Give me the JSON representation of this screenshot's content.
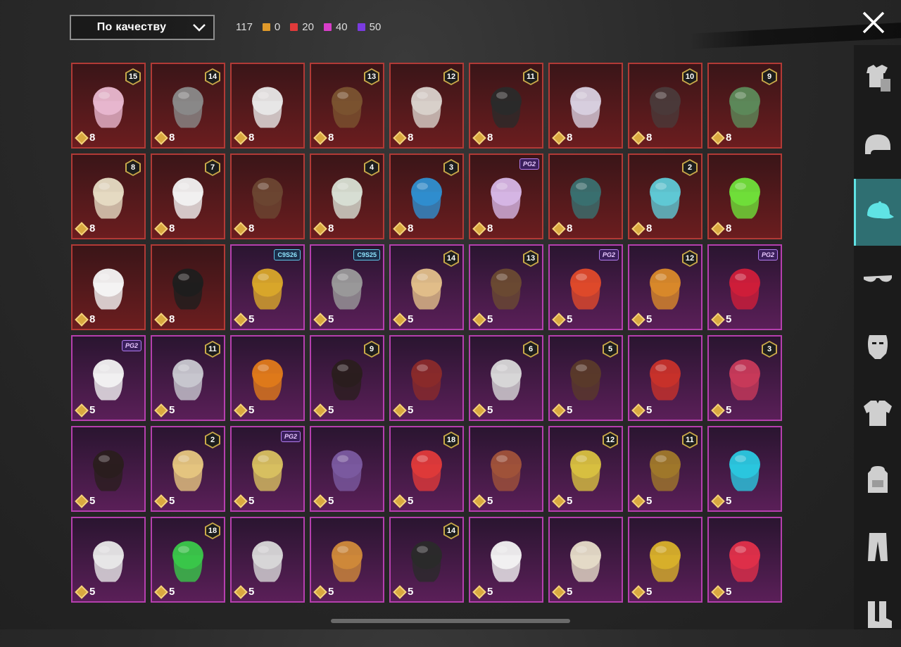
{
  "sort": {
    "label": "По качеству"
  },
  "counts": [
    {
      "value": "117",
      "color": null
    },
    {
      "value": "0",
      "color": "#e09a2a"
    },
    {
      "value": "20",
      "color": "#e03a3a"
    },
    {
      "value": "40",
      "color": "#d83ec9"
    },
    {
      "value": "50",
      "color": "#7a3be0"
    }
  ],
  "close_icon": "close-icon",
  "sidebar": [
    {
      "icon": "outfit-icon",
      "active": false
    },
    {
      "icon": "helmet-icon",
      "active": false
    },
    {
      "icon": "cap-icon",
      "active": true
    },
    {
      "icon": "glasses-icon",
      "active": false
    },
    {
      "icon": "mask-icon",
      "active": false
    },
    {
      "icon": "jacket-icon",
      "active": false
    },
    {
      "icon": "backpack-icon",
      "active": false
    },
    {
      "icon": "pants-icon",
      "active": false
    },
    {
      "icon": "boots-icon",
      "active": false
    }
  ],
  "items": [
    {
      "rarity": "red",
      "badge": "15",
      "price": "8",
      "color": "#e9b8d0"
    },
    {
      "rarity": "red",
      "badge": "14",
      "price": "8",
      "color": "#8a8a8a"
    },
    {
      "rarity": "red",
      "badge": "",
      "price": "8",
      "color": "#e8e8e8"
    },
    {
      "rarity": "red",
      "badge": "13",
      "price": "8",
      "color": "#7a5330"
    },
    {
      "rarity": "red",
      "badge": "12",
      "price": "8",
      "color": "#d9d2cc"
    },
    {
      "rarity": "red",
      "badge": "11",
      "price": "8",
      "color": "#2a2a2a"
    },
    {
      "rarity": "red",
      "badge": "",
      "price": "8",
      "color": "#d8d0e0"
    },
    {
      "rarity": "red",
      "badge": "10",
      "price": "8",
      "color": "#4a3a3a"
    },
    {
      "rarity": "red",
      "badge": "9",
      "price": "8",
      "color": "#5d8a5a"
    },
    {
      "rarity": "red",
      "badge": "8",
      "price": "8",
      "color": "#e6dcc4"
    },
    {
      "rarity": "red",
      "badge": "7",
      "price": "8",
      "color": "#f2f2f2"
    },
    {
      "rarity": "red",
      "badge": "",
      "price": "8",
      "color": "#6b4632"
    },
    {
      "rarity": "red",
      "badge": "4",
      "price": "8",
      "color": "#d8e0d4"
    },
    {
      "rarity": "red",
      "badge": "3",
      "price": "8",
      "color": "#2f8fd0"
    },
    {
      "rarity": "red",
      "badge": "PG2",
      "price": "8",
      "color": "#d6b6e6",
      "tag": "p"
    },
    {
      "rarity": "red",
      "badge": "",
      "price": "8",
      "color": "#3a7070"
    },
    {
      "rarity": "red",
      "badge": "2",
      "price": "8",
      "color": "#5fc9d6"
    },
    {
      "rarity": "red",
      "badge": "",
      "price": "8",
      "color": "#6fe03a"
    },
    {
      "rarity": "red",
      "badge": "",
      "price": "8",
      "color": "#f5f5f5"
    },
    {
      "rarity": "red",
      "badge": "",
      "price": "8",
      "color": "#1e1e1e"
    },
    {
      "rarity": "purple",
      "badge": "C9S26",
      "price": "5",
      "color": "#d9a72a",
      "tag": "c"
    },
    {
      "rarity": "purple",
      "badge": "C9S25",
      "price": "5",
      "color": "#9a9a9a",
      "tag": "c"
    },
    {
      "rarity": "purple",
      "badge": "14",
      "price": "5",
      "color": "#e2bf8a"
    },
    {
      "rarity": "purple",
      "badge": "13",
      "price": "5",
      "color": "#6a4a32"
    },
    {
      "rarity": "purple",
      "badge": "PG2",
      "price": "5",
      "color": "#e04a2a",
      "tag": "p"
    },
    {
      "rarity": "purple",
      "badge": "12",
      "price": "5",
      "color": "#d98a2a"
    },
    {
      "rarity": "purple",
      "badge": "PG2",
      "price": "5",
      "color": "#d01e3a",
      "tag": "p"
    },
    {
      "rarity": "purple",
      "badge": "PG2",
      "price": "5",
      "color": "#f2f2f2",
      "tag": "p"
    },
    {
      "rarity": "purple",
      "badge": "11",
      "price": "5",
      "color": "#c8c8d0"
    },
    {
      "rarity": "purple",
      "badge": "",
      "price": "5",
      "color": "#e07a1a"
    },
    {
      "rarity": "purple",
      "badge": "9",
      "price": "5",
      "color": "#2a1e1e"
    },
    {
      "rarity": "purple",
      "badge": "",
      "price": "5",
      "color": "#8a2a2a"
    },
    {
      "rarity": "purple",
      "badge": "6",
      "price": "5",
      "color": "#d8d8d8"
    },
    {
      "rarity": "purple",
      "badge": "5",
      "price": "5",
      "color": "#5a3a2a"
    },
    {
      "rarity": "purple",
      "badge": "",
      "price": "5",
      "color": "#c8322a"
    },
    {
      "rarity": "purple",
      "badge": "3",
      "price": "5",
      "color": "#c83a5a"
    },
    {
      "rarity": "purple",
      "badge": "",
      "price": "5",
      "color": "#2a1e1e"
    },
    {
      "rarity": "purple",
      "badge": "2",
      "price": "5",
      "color": "#e6c680"
    },
    {
      "rarity": "purple",
      "badge": "PG2",
      "price": "5",
      "color": "#d8c060",
      "tag": "p"
    },
    {
      "rarity": "purple",
      "badge": "",
      "price": "5",
      "color": "#7a5aa0"
    },
    {
      "rarity": "purple",
      "badge": "18",
      "price": "5",
      "color": "#e03a3a"
    },
    {
      "rarity": "purple",
      "badge": "",
      "price": "5",
      "color": "#a0523a"
    },
    {
      "rarity": "purple",
      "badge": "12",
      "price": "5",
      "color": "#d8c040"
    },
    {
      "rarity": "purple",
      "badge": "11",
      "price": "5",
      "color": "#a0782a"
    },
    {
      "rarity": "purple",
      "badge": "",
      "price": "5",
      "color": "#2ac8e0"
    },
    {
      "rarity": "purple",
      "badge": "",
      "price": "5",
      "color": "#e8e8e8"
    },
    {
      "rarity": "purple",
      "badge": "18",
      "price": "5",
      "color": "#3ac84a"
    },
    {
      "rarity": "purple",
      "badge": "",
      "price": "5",
      "color": "#d8d8d8"
    },
    {
      "rarity": "purple",
      "badge": "",
      "price": "5",
      "color": "#d08a3a"
    },
    {
      "rarity": "purple",
      "badge": "14",
      "price": "5",
      "color": "#2a2a2a"
    },
    {
      "rarity": "purple",
      "badge": "",
      "price": "5",
      "color": "#f2f2f2"
    },
    {
      "rarity": "purple",
      "badge": "",
      "price": "5",
      "color": "#e6dcc8"
    },
    {
      "rarity": "purple",
      "badge": "",
      "price": "5",
      "color": "#d8b02a"
    },
    {
      "rarity": "purple",
      "badge": "",
      "price": "5",
      "color": "#e0304a"
    }
  ]
}
